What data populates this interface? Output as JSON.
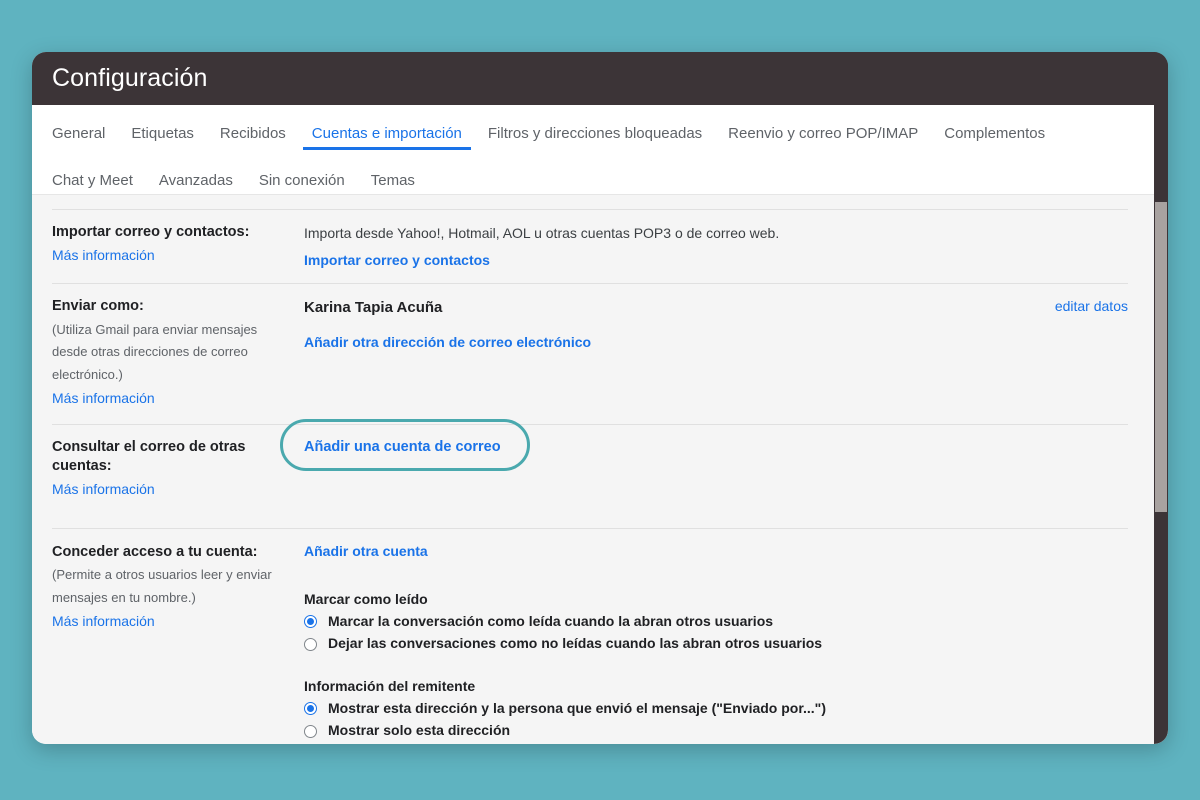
{
  "window": {
    "title": "Configuración"
  },
  "tabs": {
    "row1": [
      {
        "label": "General",
        "active": false
      },
      {
        "label": "Etiquetas",
        "active": false
      },
      {
        "label": "Recibidos",
        "active": false
      },
      {
        "label": "Cuentas e importación",
        "active": true
      },
      {
        "label": "Filtros y direcciones bloqueadas",
        "active": false
      },
      {
        "label": "Reenvio y correo POP/IMAP",
        "active": false
      },
      {
        "label": "Complementos",
        "active": false
      }
    ],
    "row2": [
      {
        "label": "Chat y Meet",
        "active": false
      },
      {
        "label": "Avanzadas",
        "active": false
      },
      {
        "label": "Sin conexión",
        "active": false
      },
      {
        "label": "Temas",
        "active": false
      }
    ]
  },
  "sections": {
    "import": {
      "label": "Importar correo y contactos:",
      "more_info": "Más información",
      "description": "Importa desde Yahoo!, Hotmail, AOL u otras cuentas POP3 o de correo web.",
      "action": "Importar correo y contactos"
    },
    "send_as": {
      "label": "Enviar como:",
      "note": "(Utiliza Gmail para enviar mensajes desde otras direcciones de correo electrónico.)",
      "more_info": "Más información",
      "account_name": "Karina Tapia Acuña",
      "edit_link": "editar datos",
      "add_address": "Añadir otra dirección de correo electrónico"
    },
    "check_mail": {
      "label": "Consultar el correo de otras cuentas:",
      "more_info": "Más información",
      "add_account_button": "Añadir una cuenta de correo"
    },
    "grant_access": {
      "label": "Conceder acceso a tu cuenta:",
      "note": "(Permite a otros usuarios leer y enviar mensajes en tu nombre.)",
      "more_info": "Más información",
      "add_other_account": "Añadir otra cuenta",
      "mark_read": {
        "title": "Marcar como leído",
        "options": [
          {
            "label": "Marcar la conversación como leída cuando la abran otros usuarios",
            "selected": true
          },
          {
            "label": "Dejar las conversaciones como no leídas cuando las abran otros usuarios",
            "selected": false
          }
        ]
      },
      "sender_info": {
        "title": "Información del remitente",
        "options": [
          {
            "label": "Mostrar esta dirección y la persona que envió el mensaje (\"Enviado por...\")",
            "selected": true
          },
          {
            "label": "Mostrar solo esta dirección",
            "selected": false
          }
        ]
      }
    }
  },
  "colors": {
    "page_background": "#5fb3c0",
    "titlebar": "#3c3437",
    "accent_link": "#1a73e8",
    "highlight_outline": "#4aa9ae",
    "content_background": "#f5f5f5"
  }
}
